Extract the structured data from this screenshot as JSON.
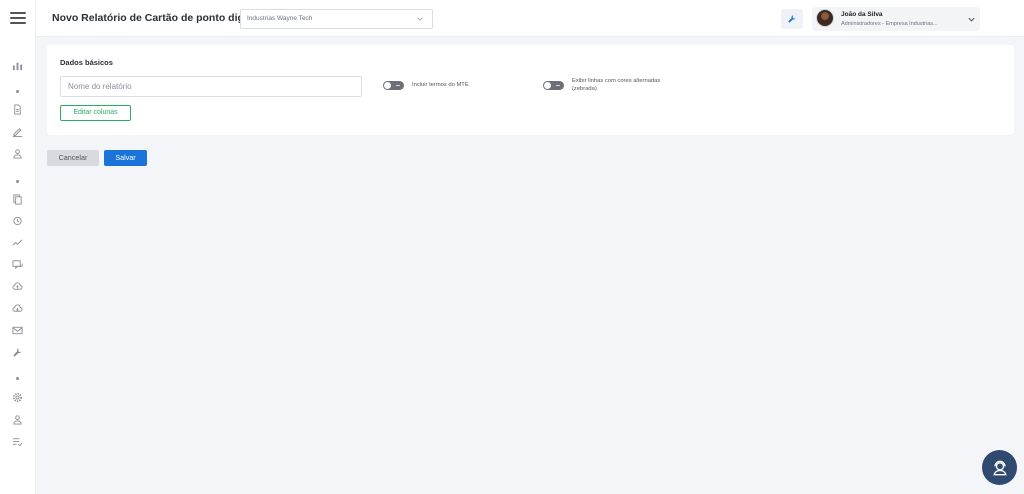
{
  "header": {
    "title": "Novo Relatório de Cartão de ponto digital",
    "company_select": {
      "value": "Industrias Wayne Tech"
    },
    "user": {
      "name": "João da Silva",
      "role": "Administradores - Empresa Industrias..."
    }
  },
  "sidebar": {
    "icons": [
      "menu-icon",
      "chart-icon",
      "document-icon",
      "edit-icon",
      "user-icon",
      "copy-icon",
      "alarm-icon",
      "trend-icon",
      "chat-icon",
      "cloud-upload-icon",
      "cloud-download-icon",
      "mail-icon",
      "wrench-icon",
      "gear-icon",
      "person-icon",
      "list-check-icon"
    ]
  },
  "form": {
    "section_title": "Dados básicos",
    "name_input": {
      "placeholder": "Nome do relatório",
      "value": ""
    },
    "toggle_mte": {
      "label": "Incluir termos do MTE",
      "on": false
    },
    "toggle_zebra": {
      "label_line1": "Exibir linhas com cores alternadas",
      "label_line2": "(zebrada)",
      "on": false
    },
    "edit_columns_label": "Editar colunas"
  },
  "actions": {
    "cancel_label": "Cancelar",
    "save_label": "Salvar"
  },
  "colors": {
    "primary": "#1a73d8",
    "success": "#27ae60",
    "help": "#2f4a6e"
  }
}
